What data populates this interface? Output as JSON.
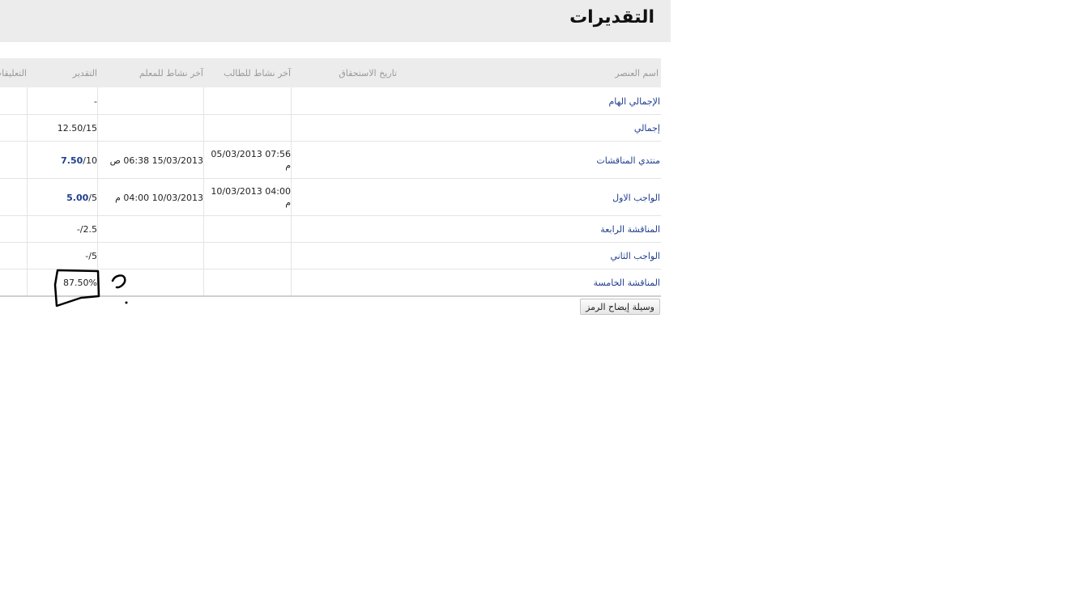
{
  "page": {
    "title": "التقديرات"
  },
  "table": {
    "headers": {
      "item_name": "اسم العنصر",
      "due_date": "تاريخ الاستحقاق",
      "student_activity": "آخر نشاط للطالب",
      "teacher_activity": "آخر نشاط للمعلم",
      "grade": "التقدير",
      "comments": "التعليقات"
    },
    "rows": [
      {
        "name": "الإجمالي الهام",
        "student_activity": "",
        "teacher_activity": "",
        "grade_main": "-",
        "grade_total": ""
      },
      {
        "name": "إجمالي",
        "student_activity": "",
        "teacher_activity": "",
        "grade_main": "12.50",
        "grade_total": "/15"
      },
      {
        "name": "منتدي المناقشات",
        "student_activity": "07:56 05/03/2013 م",
        "teacher_activity": "15/03/2013 06:38 ص",
        "grade_main": "7.50",
        "grade_total": "/10"
      },
      {
        "name": "الواجب الاول",
        "student_activity": "04:00 10/03/2013 م",
        "teacher_activity": "10/03/2013 04:00 م",
        "grade_main": "5.00",
        "grade_total": "/5"
      },
      {
        "name": "المناقشة الرابعة",
        "student_activity": "",
        "teacher_activity": "",
        "grade_main": "-",
        "grade_total": "/2.5"
      },
      {
        "name": "الواجب الثاني",
        "student_activity": "",
        "teacher_activity": "",
        "grade_main": "-",
        "grade_total": "/5"
      },
      {
        "name": "المناقشة الخامسة",
        "student_activity": "",
        "teacher_activity": "",
        "grade_main": "87.50%",
        "grade_total": ""
      }
    ]
  },
  "footer": {
    "legend_button_label": "وسيلة إيضاح الرمز"
  },
  "colors": {
    "link": "#1f3d8f",
    "header_bg": "#ececec",
    "annotation": "#000000"
  }
}
